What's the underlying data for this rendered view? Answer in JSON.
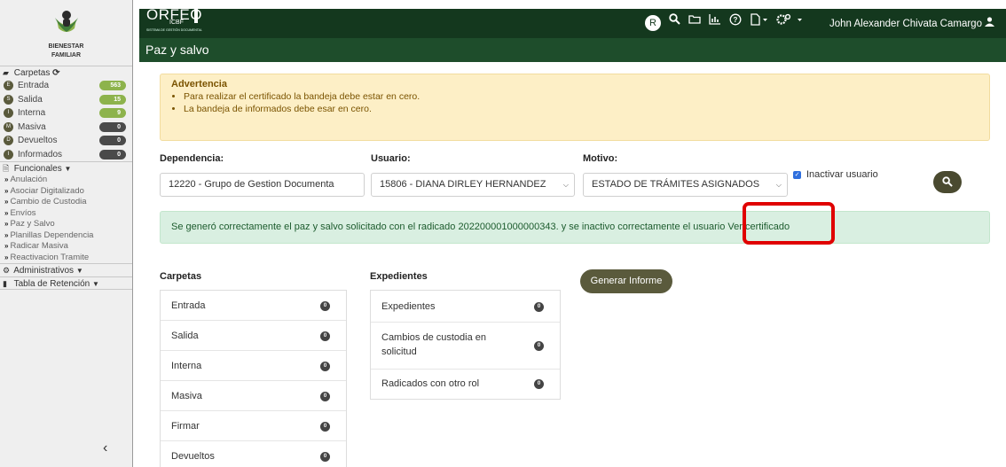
{
  "sidebar": {
    "logo_text": [
      "BIENESTAR",
      "FAMILIAR"
    ],
    "carpetas_label": "Carpetas",
    "folders": [
      {
        "letter": "E",
        "label": "Entrada",
        "count": "563",
        "color": "#8db34c"
      },
      {
        "letter": "S",
        "label": "Salida",
        "count": "15",
        "color": "#8db34c"
      },
      {
        "letter": "I",
        "label": "Interna",
        "count": "9",
        "color": "#8db34c"
      },
      {
        "letter": "M",
        "label": "Masiva",
        "count": "0",
        "color": "#4a4a4a"
      },
      {
        "letter": "D",
        "label": "Devueltos",
        "count": "0",
        "color": "#4a4a4a"
      },
      {
        "letter": "I",
        "label": "Informados",
        "count": "0",
        "color": "#4a4a4a"
      }
    ],
    "funcionales_label": "Funcionales",
    "funcionales_items": [
      "Anulación",
      "Asociar Digitalizado",
      "Cambio de Custodia",
      "Envíos",
      "Paz y Salvo",
      "Planillas Dependencia",
      "Radicar Masiva",
      "Reactivacion Tramite"
    ],
    "administrativos_label": "Administrativos",
    "tabla_label": "Tabla de Retención",
    "collapse_glyph": "‹"
  },
  "header": {
    "brand": "ORFEO",
    "brand_sub": "ICBF",
    "brand_tagline": "SISTEMA DE GESTIÓN DOCUMENTAL",
    "avatar_letter": "R",
    "user_name": "John Alexander Chivata Camargo",
    "page_title": "Paz y salvo",
    "theme_color": "#14381e"
  },
  "warning": {
    "title": "Advertencia",
    "items": [
      "Para realizar el certificado la bandeja debe estar en cero.",
      "La bandeja de informados debe esar en cero."
    ]
  },
  "form": {
    "dependencia_label": "Dependencia:",
    "dependencia_value": "12220 - Grupo de Gestion Documenta",
    "usuario_label": "Usuario:",
    "usuario_value": "15806 - DIANA DIRLEY HERNANDEZ",
    "motivo_label": "Motivo:",
    "motivo_value": "ESTADO DE TRÁMITES ASIGNADOS",
    "inactivar_label": "Inactivar usuario",
    "inactivar_checked": true
  },
  "success": {
    "message": "Se generó correctamente el paz y salvo solicitado con el radicado 202200001000000343. y se inactivo correctamente el usuario",
    "link": "Ver certificado"
  },
  "carpetas": {
    "title": "Carpetas",
    "items": [
      {
        "label": "Entrada",
        "count": "0"
      },
      {
        "label": "Salida",
        "count": "0"
      },
      {
        "label": "Interna",
        "count": "0"
      },
      {
        "label": "Masiva",
        "count": "0"
      },
      {
        "label": "Firmar",
        "count": "0"
      },
      {
        "label": "Devueltos",
        "count": "0"
      }
    ]
  },
  "expedientes": {
    "title": "Expedientes",
    "items": [
      {
        "label": "Expedientes",
        "count": "0"
      },
      {
        "label": "Cambios de custodia en solicitud",
        "count": "0"
      },
      {
        "label": "Radicados con otro rol",
        "count": "0"
      }
    ]
  },
  "generate_button": "Generar Informe"
}
